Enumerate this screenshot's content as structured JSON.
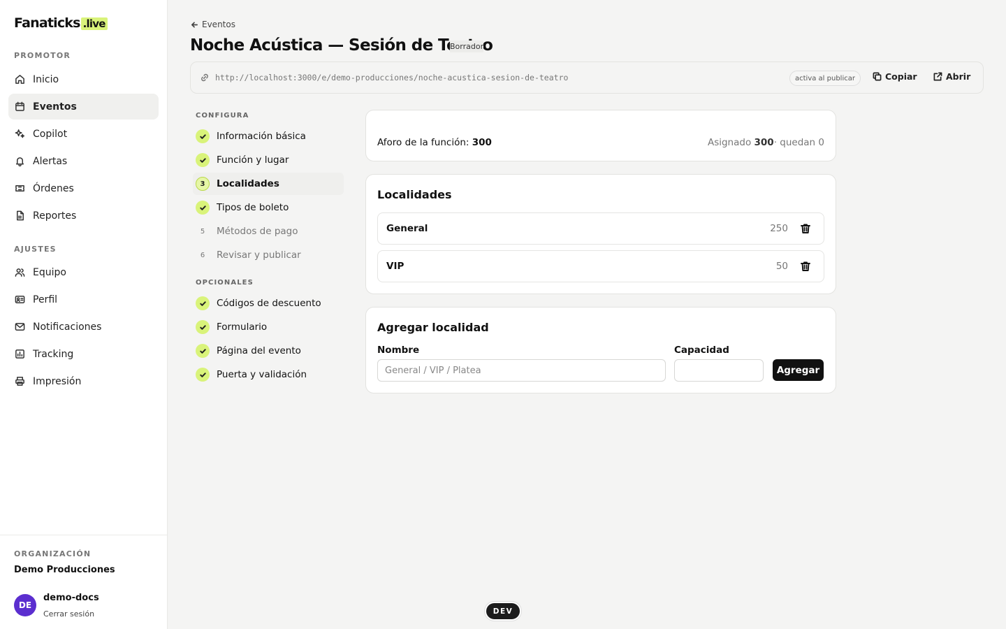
{
  "brand": {
    "name": "Fanaticks",
    "suffix": ".live",
    "accent": "#d9f37a"
  },
  "sidebar": {
    "section_promotor": "PROMOTOR",
    "section_ajustes": "AJUSTES",
    "items": [
      {
        "label": "Inicio",
        "icon": "home-icon"
      },
      {
        "label": "Eventos",
        "icon": "calendar-icon",
        "active": true
      },
      {
        "label": "Copilot",
        "icon": "sparkles-icon"
      },
      {
        "label": "Alertas",
        "icon": "bell-icon"
      },
      {
        "label": "Órdenes",
        "icon": "ticket-icon"
      },
      {
        "label": "Reportes",
        "icon": "file-icon"
      },
      {
        "label": "Equipo",
        "icon": "users-icon"
      },
      {
        "label": "Perfil",
        "icon": "id-card-icon"
      },
      {
        "label": "Notificaciones",
        "icon": "mail-icon"
      },
      {
        "label": "Tracking",
        "icon": "chart-icon"
      },
      {
        "label": "Impresión",
        "icon": "printer-icon"
      }
    ],
    "footer": {
      "org_label": "ORGANIZACIÓN",
      "org_name": "Demo Producciones",
      "avatar_initials": "DE",
      "avatar_color": "#5b2ecf",
      "user_name": "demo-docs",
      "logout_label": "Cerrar sesión"
    }
  },
  "header": {
    "back_label": "Eventos",
    "title": "Noche Acústica — Sesión de Teatro",
    "status": "Borrador",
    "url": "http://localhost:3000/e/demo-producciones/noche-acustica-sesion-de-teatro",
    "url_pill": "activa al publicar",
    "copy_label": "Copiar",
    "open_label": "Abrir"
  },
  "steps": {
    "configura_label": "CONFIGURA",
    "opcionales_label": "OPCIONALES",
    "configura": [
      {
        "label": "Información básica",
        "state": "done"
      },
      {
        "label": "Función y lugar",
        "state": "done"
      },
      {
        "label": "Localidades",
        "state": "current",
        "number": "3"
      },
      {
        "label": "Tipos de boleto",
        "state": "done"
      },
      {
        "label": "Métodos de pago",
        "state": "todo",
        "number": "5"
      },
      {
        "label": "Revisar y publicar",
        "state": "todo",
        "number": "6"
      }
    ],
    "opcionales": [
      {
        "label": "Códigos de descuento",
        "state": "done"
      },
      {
        "label": "Formulario",
        "state": "done"
      },
      {
        "label": "Página del evento",
        "state": "done"
      },
      {
        "label": "Puerta y validación",
        "state": "done"
      }
    ]
  },
  "capacity": {
    "label": "Aforo de la función:",
    "value": "300",
    "assigned_label": "Asignado",
    "assigned_value": "300",
    "remaining_text": "· quedan 0"
  },
  "localidades": {
    "title": "Localidades",
    "rows": [
      {
        "name": "General",
        "capacity": "250"
      },
      {
        "name": "VIP",
        "capacity": "50"
      }
    ]
  },
  "add_form": {
    "title": "Agregar localidad",
    "name_label": "Nombre",
    "name_placeholder": "General / VIP / Platea",
    "name_value": "",
    "capacity_label": "Capacidad",
    "capacity_value": "",
    "submit_label": "Agregar"
  },
  "env_badge": "DEV"
}
